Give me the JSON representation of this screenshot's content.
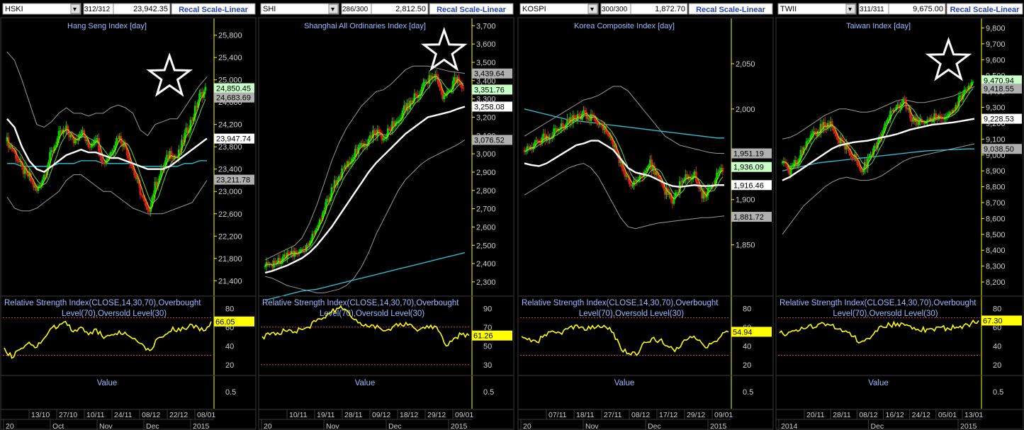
{
  "panels": [
    {
      "symbol": "HSKI",
      "counter": "312/312",
      "last_price": "23,942.35",
      "recal_label": "Recal Scale-Linear",
      "bg_color": "#000000",
      "price_color": "#00ff00",
      "chart_data": {
        "type": "candlestick",
        "title": "Hang Seng Index [day]",
        "y_ticks": [
          21400,
          21800,
          22200,
          22600,
          23000,
          23400,
          23800,
          24200,
          24600,
          25000,
          25400,
          25800
        ],
        "ylim": [
          21150,
          26100
        ],
        "overlay": {
          "upper_band": 1,
          "lower_band": 1,
          "ma_white": 1,
          "ma_cyan": 1,
          "ma_yellow": 1
        },
        "path": [
          23900,
          23700,
          23400,
          23250,
          23000,
          23300,
          23700,
          24000,
          24100,
          23900,
          24100,
          23800,
          24000,
          23500,
          23700,
          24000,
          23800,
          23400,
          23000,
          22600,
          23100,
          23400,
          23700,
          23600,
          24000,
          24300,
          24700,
          24850
        ],
        "upper_path": [
          25500,
          25350,
          25000,
          24600,
          24200,
          24150,
          24250,
          24400,
          24500,
          24400,
          24400,
          24350,
          24400,
          24400,
          24500,
          24550,
          24500,
          24400,
          24100,
          24000,
          24200,
          24250,
          24300,
          24300,
          24500,
          24700,
          24900,
          25050
        ],
        "lower_path": [
          22900,
          22700,
          22650,
          22650,
          22700,
          22800,
          22900,
          23000,
          23200,
          23300,
          23300,
          23200,
          23100,
          23000,
          23000,
          22900,
          22800,
          22700,
          22650,
          22600,
          22600,
          22600,
          22650,
          22700,
          22750,
          22800,
          23000,
          23200
        ],
        "ma_white_path": [
          24300,
          24150,
          23800,
          23550,
          23400,
          23350,
          23450,
          23550,
          23650,
          23700,
          23750,
          23700,
          23700,
          23650,
          23600,
          23600,
          23550,
          23500,
          23450,
          23400,
          23400,
          23400,
          23450,
          23550,
          23650,
          23750,
          23850,
          23950
        ],
        "ma_cyan_path": [
          23500,
          23500,
          23450,
          23450,
          23450,
          23450,
          23450,
          23500,
          23500,
          23500,
          23550,
          23550,
          23550,
          23500,
          23500,
          23500,
          23500,
          23500,
          23450,
          23450,
          23450,
          23450,
          23450,
          23450,
          23500,
          23500,
          23550,
          23550
        ],
        "price_labels": [
          {
            "text": "24,850.45",
            "value": 24850,
            "bg": "#c8ffc8"
          },
          {
            "text": "24,683.69",
            "value": 24683,
            "bg": "#b0b0b0"
          },
          {
            "text": "23,947.74",
            "value": 23947,
            "bg": "#ffffff"
          },
          {
            "text": "23,211.78",
            "value": 23211,
            "bg": "#b0b0b0"
          }
        ],
        "star": {
          "col": 0.8,
          "value": 25050
        },
        "rsi_title": "Relative Strength Index(CLOSE,14,30,70),Overbought Level(70),Oversold Level(30)",
        "rsi_ticks": [
          80,
          60,
          40,
          20
        ],
        "rsi_ylim": [
          10,
          90
        ],
        "rsi_levels": [
          70,
          30
        ],
        "rsi_path": [
          38,
          27,
          36,
          42,
          38,
          46,
          58,
          60,
          66,
          55,
          60,
          52,
          58,
          48,
          52,
          56,
          52,
          48,
          42,
          35,
          48,
          52,
          60,
          56,
          60,
          62,
          56,
          66
        ],
        "rsi_value": "66.05",
        "value_label": "Value",
        "value_tick": "0.5",
        "xlabels_top": [
          "13/10",
          "27/10",
          "10/11",
          "24/11",
          "08/12",
          "22/12",
          "08/01"
        ],
        "xlabels_bottom": [
          "20",
          "Oct",
          "Nov",
          "Dec",
          "2015"
        ]
      }
    },
    {
      "symbol": "SHI",
      "counter": "286/300",
      "last_price": "2,812.50",
      "recal_label": "Recal Scale-Linear",
      "chart_data": {
        "type": "candlestick",
        "title": "Shanghai All Ordinaries Index [day]",
        "y_ticks": [
          2300,
          2400,
          2500,
          2600,
          2700,
          2800,
          2900,
          3000,
          3100,
          3200,
          3300,
          3400,
          3500,
          3600,
          3700
        ],
        "ylim": [
          2230,
          3740
        ],
        "path": [
          2380,
          2400,
          2420,
          2440,
          2460,
          2480,
          2520,
          2600,
          2700,
          2800,
          2880,
          2950,
          3000,
          3050,
          3080,
          3120,
          3080,
          3150,
          3200,
          3250,
          3300,
          3350,
          3400,
          3420,
          3300,
          3350,
          3420,
          3351
        ],
        "upper_path": [
          2420,
          2440,
          2460,
          2480,
          2500,
          2540,
          2620,
          2720,
          2840,
          2960,
          3060,
          3140,
          3200,
          3260,
          3300,
          3340,
          3350,
          3380,
          3420,
          3460,
          3480,
          3480,
          3480,
          3470,
          3460,
          3450,
          3445,
          3440
        ],
        "lower_path": [
          2330,
          2320,
          2300,
          2280,
          2270,
          2260,
          2250,
          2240,
          2240,
          2250,
          2260,
          2280,
          2320,
          2380,
          2460,
          2560,
          2640,
          2720,
          2800,
          2860,
          2900,
          2940,
          2970,
          2990,
          3010,
          3030,
          3050,
          3076
        ],
        "ma_white_path": [
          2350,
          2360,
          2375,
          2390,
          2410,
          2430,
          2460,
          2500,
          2550,
          2600,
          2660,
          2720,
          2780,
          2840,
          2900,
          2950,
          2990,
          3030,
          3070,
          3110,
          3140,
          3170,
          3200,
          3210,
          3220,
          3230,
          3245,
          3258
        ],
        "ma_cyan_path": [
          2200,
          2210,
          2220,
          2230,
          2240,
          2250,
          2255,
          2260,
          2270,
          2280,
          2290,
          2300,
          2310,
          2320,
          2330,
          2340,
          2350,
          2360,
          2370,
          2380,
          2390,
          2400,
          2410,
          2420,
          2430,
          2440,
          2450,
          2460
        ],
        "price_labels": [
          {
            "text": "3,439.64",
            "value": 3439,
            "bg": "#b0b0b0"
          },
          {
            "text": "3,351.76",
            "value": 3351,
            "bg": "#c8ffc8"
          },
          {
            "text": "3,258.08",
            "value": 3258,
            "bg": "#ffffff"
          },
          {
            "text": "3,076.52",
            "value": 3076,
            "bg": "#b0b0b0"
          }
        ],
        "star": {
          "col": 0.88,
          "value": 3560
        },
        "rsi_title": "Relative Strength Index(CLOSE,14,30,70),Overbought Level(70),Oversold Level(30)",
        "rsi_ticks": [
          90,
          70,
          50,
          30
        ],
        "rsi_ylim": [
          20,
          100
        ],
        "rsi_levels": [
          70,
          30
        ],
        "rsi_path": [
          60,
          62,
          64,
          66,
          64,
          68,
          70,
          76,
          80,
          86,
          90,
          88,
          78,
          72,
          70,
          72,
          66,
          70,
          74,
          72,
          68,
          70,
          72,
          66,
          50,
          58,
          62,
          61
        ],
        "rsi_value": "61.26",
        "value_label": "Value",
        "value_tick": "0.5",
        "xlabels_top": [
          "10/11",
          "19/11",
          "28/11",
          "09/12",
          "18/12",
          "29/12",
          "09/01"
        ],
        "xlabels_bottom": [
          "20",
          "Nov",
          "Dec",
          "2015"
        ]
      }
    },
    {
      "symbol": "KOSPI",
      "counter": "300/300",
      "last_price": "1,872.70",
      "recal_label": "Recal Scale-Linear",
      "chart_data": {
        "type": "candlestick",
        "title": "Korea Composite Index [day]",
        "y_ticks": [
          1850,
          1900,
          1950,
          2000,
          2050
        ],
        "ylim": [
          1795,
          2100
        ],
        "path": [
          1955,
          1960,
          1965,
          1970,
          1975,
          1980,
          1985,
          1990,
          1995,
          1990,
          1985,
          1975,
          1960,
          1940,
          1920,
          1915,
          1930,
          1940,
          1925,
          1910,
          1900,
          1915,
          1925,
          1930,
          1905,
          1910,
          1925,
          1936
        ],
        "upper_path": [
          1970,
          1975,
          1980,
          1985,
          1990,
          1995,
          2000,
          2005,
          2010,
          2012,
          2015,
          2020,
          2025,
          2025,
          2020,
          2010,
          2000,
          1990,
          1980,
          1970,
          1965,
          1960,
          1958,
          1956,
          1954,
          1952,
          1951,
          1951
        ],
        "lower_path": [
          1905,
          1910,
          1915,
          1920,
          1925,
          1930,
          1935,
          1938,
          1940,
          1935,
          1925,
          1910,
          1895,
          1880,
          1870,
          1868,
          1870,
          1872,
          1874,
          1875,
          1876,
          1877,
          1878,
          1879,
          1880,
          1880,
          1881,
          1882
        ],
        "ma_white_path": [
          1940,
          1938,
          1937,
          1940,
          1945,
          1950,
          1955,
          1960,
          1962,
          1965,
          1965,
          1960,
          1955,
          1945,
          1935,
          1930,
          1928,
          1926,
          1922,
          1918,
          1915,
          1914,
          1915,
          1916,
          1915,
          1915,
          1916,
          1916
        ],
        "ma_cyan_path": [
          2000,
          1998,
          1996,
          1994,
          1992,
          1990,
          1988,
          1987,
          1986,
          1985,
          1984,
          1983,
          1982,
          1981,
          1980,
          1979,
          1978,
          1977,
          1976,
          1975,
          1974,
          1973,
          1972,
          1971,
          1970,
          1969,
          1968,
          1968
        ],
        "price_labels": [
          {
            "text": "1,951.19",
            "value": 1951,
            "bg": "#b0b0b0"
          },
          {
            "text": "1,936.09",
            "value": 1936,
            "bg": "#c8ffc8"
          },
          {
            "text": "1,916.46",
            "value": 1916,
            "bg": "#ffffff"
          },
          {
            "text": "1,881.72",
            "value": 1881,
            "bg": "#b0b0b0"
          }
        ],
        "rsi_title": "Relative Strength Index(CLOSE,14,30,70),Overbought Level(70),Oversold Level(30)",
        "rsi_ticks": [
          80,
          60,
          40,
          20
        ],
        "rsi_ylim": [
          10,
          90
        ],
        "rsi_levels": [
          70,
          30
        ],
        "rsi_path": [
          50,
          48,
          44,
          52,
          56,
          54,
          58,
          62,
          60,
          58,
          62,
          60,
          54,
          36,
          32,
          30,
          44,
          48,
          46,
          40,
          34,
          44,
          50,
          46,
          38,
          44,
          50,
          55
        ],
        "rsi_value": "54.94",
        "value_label": "Value",
        "value_tick": "0.5",
        "xlabels_top": [
          "07/11",
          "18/11",
          "27/11",
          "08/12",
          "17/12",
          "29/12",
          "09/01"
        ],
        "xlabels_bottom": [
          "20",
          "Nov",
          "Dec",
          "2015"
        ]
      }
    },
    {
      "symbol": "TWII",
      "counter": "311/311",
      "last_price": "9,675.00",
      "recal_label": "Recal Scale-Linear",
      "chart_data": {
        "type": "candlestick",
        "title": "Taiwan Index [day]",
        "y_ticks": [
          8200,
          8300,
          8400,
          8500,
          8600,
          8700,
          8800,
          8900,
          9000,
          9100,
          9200,
          9300,
          9400,
          9500,
          9600,
          9700,
          9800
        ],
        "ylim": [
          8120,
          9860
        ],
        "path": [
          8950,
          8900,
          8950,
          9050,
          9100,
          9150,
          9200,
          9180,
          9100,
          9050,
          9000,
          8900,
          8950,
          9050,
          9150,
          9250,
          9300,
          9350,
          9250,
          9200,
          9200,
          9230,
          9250,
          9260,
          9280,
          9350,
          9420,
          9470
        ],
        "upper_path": [
          9100,
          9110,
          9130,
          9160,
          9190,
          9220,
          9250,
          9270,
          9290,
          9290,
          9280,
          9270,
          9270,
          9280,
          9300,
          9320,
          9340,
          9350,
          9340,
          9330,
          9330,
          9340,
          9350,
          9360,
          9370,
          9390,
          9410,
          9430
        ],
        "lower_path": [
          8500,
          8560,
          8620,
          8680,
          8720,
          8760,
          8800,
          8830,
          8850,
          8860,
          8850,
          8840,
          8840,
          8850,
          8870,
          8900,
          8930,
          8960,
          8980,
          8990,
          9000,
          9010,
          9020,
          9030,
          9040,
          9050,
          9060,
          9070
        ],
        "ma_white_path": [
          8840,
          8860,
          8890,
          8920,
          8950,
          8980,
          9010,
          9040,
          9060,
          9070,
          9080,
          9085,
          9090,
          9100,
          9110,
          9120,
          9130,
          9145,
          9160,
          9170,
          9180,
          9190,
          9195,
          9200,
          9205,
          9212,
          9220,
          9228
        ],
        "ma_cyan_path": [
          8900,
          8910,
          8920,
          8930,
          8940,
          8950,
          8955,
          8960,
          8965,
          8970,
          8975,
          8980,
          8985,
          8990,
          8995,
          9000,
          9005,
          9010,
          9015,
          9020,
          9025,
          9028,
          9030,
          9032,
          9034,
          9036,
          9038,
          9038
        ],
        "price_labels": [
          {
            "text": "9,470.94",
            "value": 9470,
            "bg": "#c8ffc8"
          },
          {
            "text": "9,418.55",
            "value": 9418,
            "bg": "#b0b0b0"
          },
          {
            "text": "9,228.53",
            "value": 9228,
            "bg": "#ffffff"
          },
          {
            "text": "9,038.50",
            "value": 9038,
            "bg": "#b0b0b0"
          }
        ],
        "star": {
          "col": 0.85,
          "value": 9590
        },
        "rsi_title": "Relative Strength Index(CLOSE,14,30,70),Overbought Level(70),Oversold Level(30)",
        "rsi_ticks": [
          80,
          60,
          40,
          20
        ],
        "rsi_ylim": [
          10,
          90
        ],
        "rsi_levels": [
          70,
          30
        ],
        "rsi_path": [
          54,
          52,
          56,
          60,
          62,
          60,
          64,
          62,
          58,
          56,
          50,
          44,
          48,
          56,
          60,
          62,
          64,
          62,
          58,
          56,
          58,
          56,
          60,
          58,
          60,
          62,
          64,
          67
        ],
        "rsi_value": "67.30",
        "value_label": "Value",
        "value_tick": "0.5",
        "xlabels_top": [
          "20/11",
          "28/11",
          "08/12",
          "16/12",
          "24/12",
          "05/01",
          "13/01"
        ],
        "xlabels_bottom": [
          "2014",
          "Dec",
          "2015"
        ]
      }
    }
  ]
}
